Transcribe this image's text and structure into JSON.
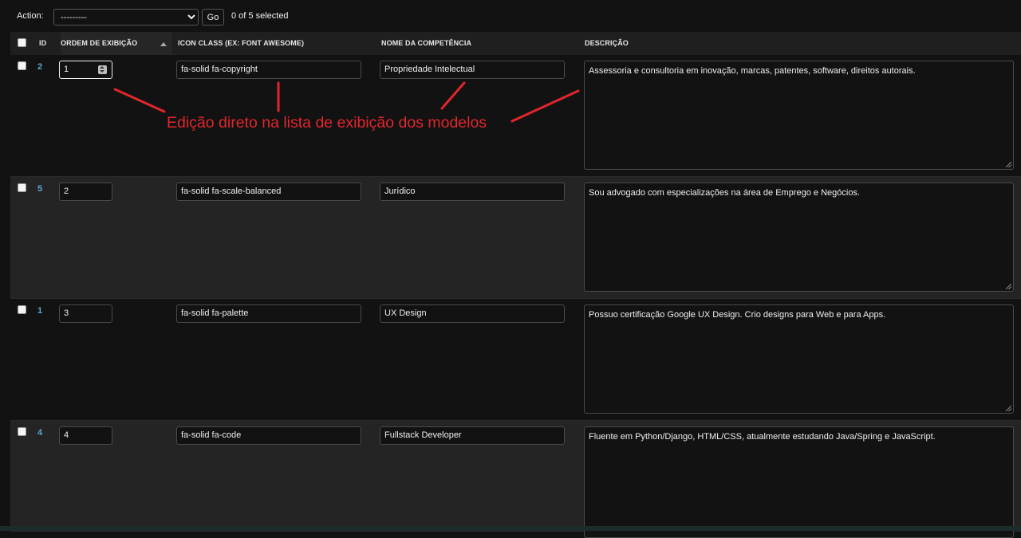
{
  "actions": {
    "label": "Action:",
    "select_value": "---------",
    "go_label": "Go",
    "selected_text": "0 of 5 selected"
  },
  "table": {
    "headers": {
      "id": "ID",
      "ordem": "ORDEM DE EXIBIÇÃO",
      "icon_class": "ICON CLASS (EX: FONT AWESOME)",
      "nome": "NOME DA COMPETÊNCIA",
      "descricao": "DESCRIÇÃO"
    },
    "rows": [
      {
        "id": "2",
        "ordem": "1",
        "icon_class": "fa-solid fa-copyright",
        "nome": "Propriedade Intelectual",
        "descricao": "Assessoria e consultoria em inovação, marcas, patentes, software, direitos autorais."
      },
      {
        "id": "5",
        "ordem": "2",
        "icon_class": "fa-solid fa-scale-balanced",
        "nome": "Jurídico",
        "descricao": "Sou advogado com especializações na área de Emprego e Negócios."
      },
      {
        "id": "1",
        "ordem": "3",
        "icon_class": "fa-solid fa-palette",
        "nome": "UX Design",
        "descricao": "Possuo certificação Google UX Design. Crio designs para Web e para Apps."
      },
      {
        "id": "4",
        "ordem": "4",
        "icon_class": "fa-solid fa-code",
        "nome": "Fullstack Developer",
        "descricao": "Fluente em Python/Django, HTML/CSS, atualmente estudando Java/Spring e JavaScript."
      }
    ]
  },
  "annotation": {
    "text": "Edição direto na lista de exibição dos modelos",
    "color": "#e0262d"
  },
  "colors": {
    "background": "#121212",
    "alt_row": "#242424",
    "link": "#5ba7d6"
  }
}
